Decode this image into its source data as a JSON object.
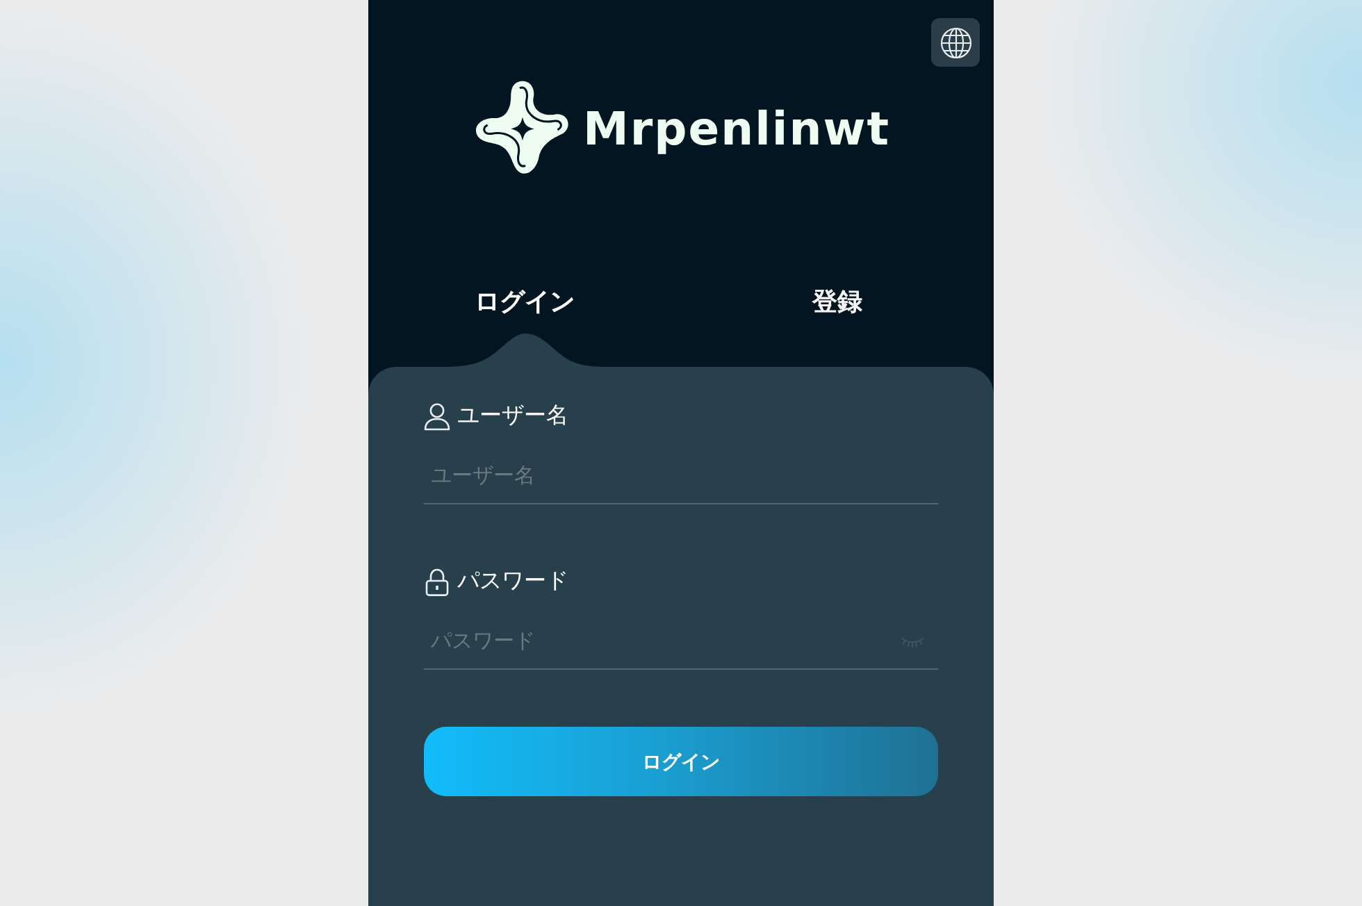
{
  "logo": {
    "text": "Mrpenlinwt"
  },
  "tabs": [
    {
      "label": "ログイン",
      "selected": true
    },
    {
      "label": "登録",
      "selected": false
    }
  ],
  "fields": [
    {
      "kind": "text",
      "label": "ユーザー名",
      "placeholder": "ユーザー名"
    },
    {
      "kind": "password",
      "label": "パスワード",
      "placeholder": "パスワード"
    }
  ],
  "submit": {
    "label": "ログイン"
  }
}
